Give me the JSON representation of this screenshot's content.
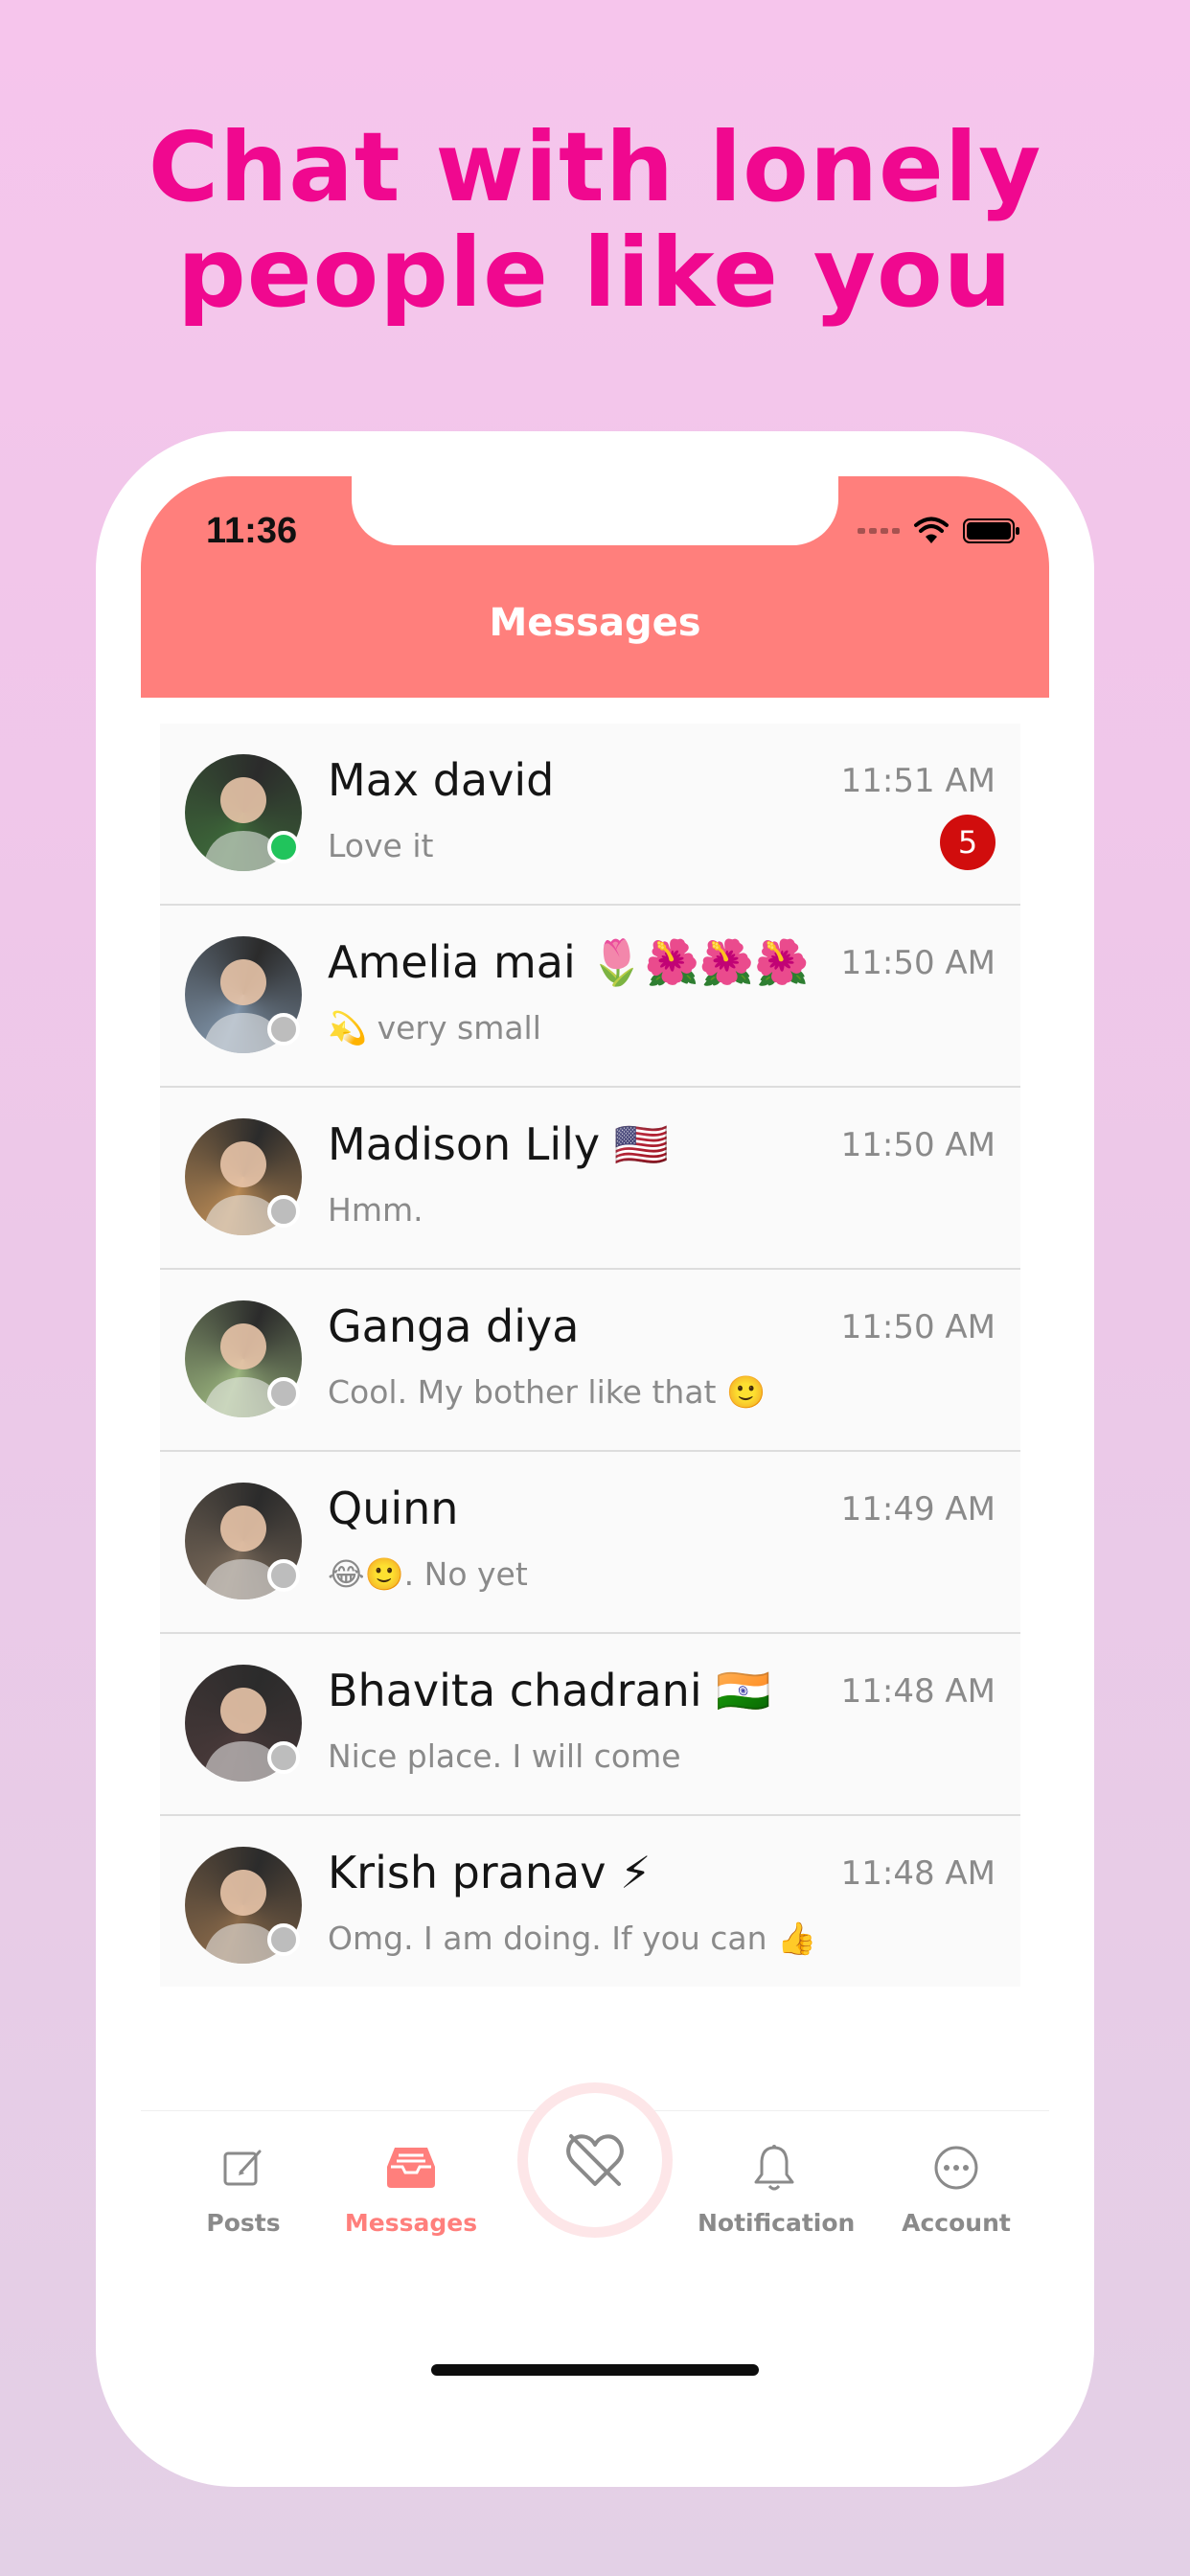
{
  "headline": [
    "Chat with lonely",
    "people like you"
  ],
  "status_bar": {
    "time": "11:36"
  },
  "header": {
    "title": "Messages"
  },
  "conversations": [
    {
      "name": "Max david",
      "message": "Love it",
      "time": "11:51 AM",
      "unread": "5",
      "online": true,
      "avatar_color": "#3e6b3a"
    },
    {
      "name": "Amelia mai 🌷🌺🌺🌺",
      "message": "💫 very small",
      "time": "11:50 AM",
      "unread": "",
      "online": false,
      "avatar_color": "#7f93a8"
    },
    {
      "name": "Madison Lily 🇺🇸",
      "message": "Hmm.",
      "time": "11:50 AM",
      "unread": "",
      "online": false,
      "avatar_color": "#b98a55"
    },
    {
      "name": "Ganga diya",
      "message": "Cool. My bother like that 🙂",
      "time": "11:50 AM",
      "unread": "",
      "online": false,
      "avatar_color": "#9bb57e"
    },
    {
      "name": "Quinn",
      "message": "😂🙂. No yet",
      "time": "11:49 AM",
      "unread": "",
      "online": false,
      "avatar_color": "#7a6a5a"
    },
    {
      "name": "Bhavita chadrani 🇮🇳",
      "message": "Nice place. I will come",
      "time": "11:48 AM",
      "unread": "",
      "online": false,
      "avatar_color": "#4a3a3a"
    },
    {
      "name": "Krish pranav ⚡",
      "message": "Omg. I am doing. If you can 👍",
      "time": "11:48 AM",
      "unread": "",
      "online": false,
      "avatar_color": "#8a6a4a"
    }
  ],
  "tabbar": {
    "posts": "Posts",
    "messages": "Messages",
    "notification": "Notification",
    "account": "Account",
    "active_tab": "messages",
    "accent": "#ff7f7c"
  },
  "colors": {
    "header": "#ff7f7c",
    "headline": "#f0088f",
    "badge": "#d10d0d",
    "online": "#21c45c"
  }
}
